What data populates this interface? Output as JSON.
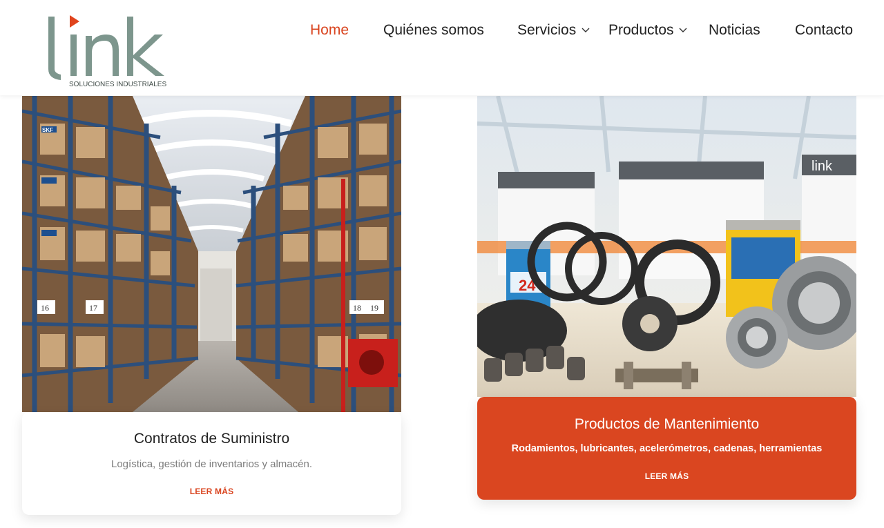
{
  "brand": {
    "logo_text": "link",
    "tagline": "SOLUCIONES INDUSTRIALES",
    "logo_color": "#7d968d",
    "accent": "#e0441d"
  },
  "nav": {
    "items": [
      {
        "label": "Home",
        "active": true
      },
      {
        "label": "Quiénes somos"
      },
      {
        "label": "Servicios",
        "dropdown": true
      },
      {
        "label": "Productos",
        "dropdown": true
      },
      {
        "label": "Noticias"
      },
      {
        "label": "Contacto"
      }
    ],
    "active_color": "#d9441f"
  },
  "cards": [
    {
      "photo_subject": "warehouse-shelving",
      "title": "Contratos de Suministro",
      "description": "Logística, gestión de inventarios y almacén.",
      "link": "LEER MÁS",
      "panel_color": "#ffffff"
    },
    {
      "photo_subject": "maintenance-products",
      "title": "Productos de Mantenimiento",
      "description": "Rodamientos, lubricantes, acelerómetros, cadenas, herramientas",
      "link": "LEER MÁS",
      "panel_color": "#da4620"
    }
  ],
  "photo_labels": {
    "brand_on_boxes": "SKF",
    "bay_numbers": [
      "16",
      "17",
      "18",
      "19"
    ],
    "can_label": "24",
    "banner_brand": "link"
  }
}
